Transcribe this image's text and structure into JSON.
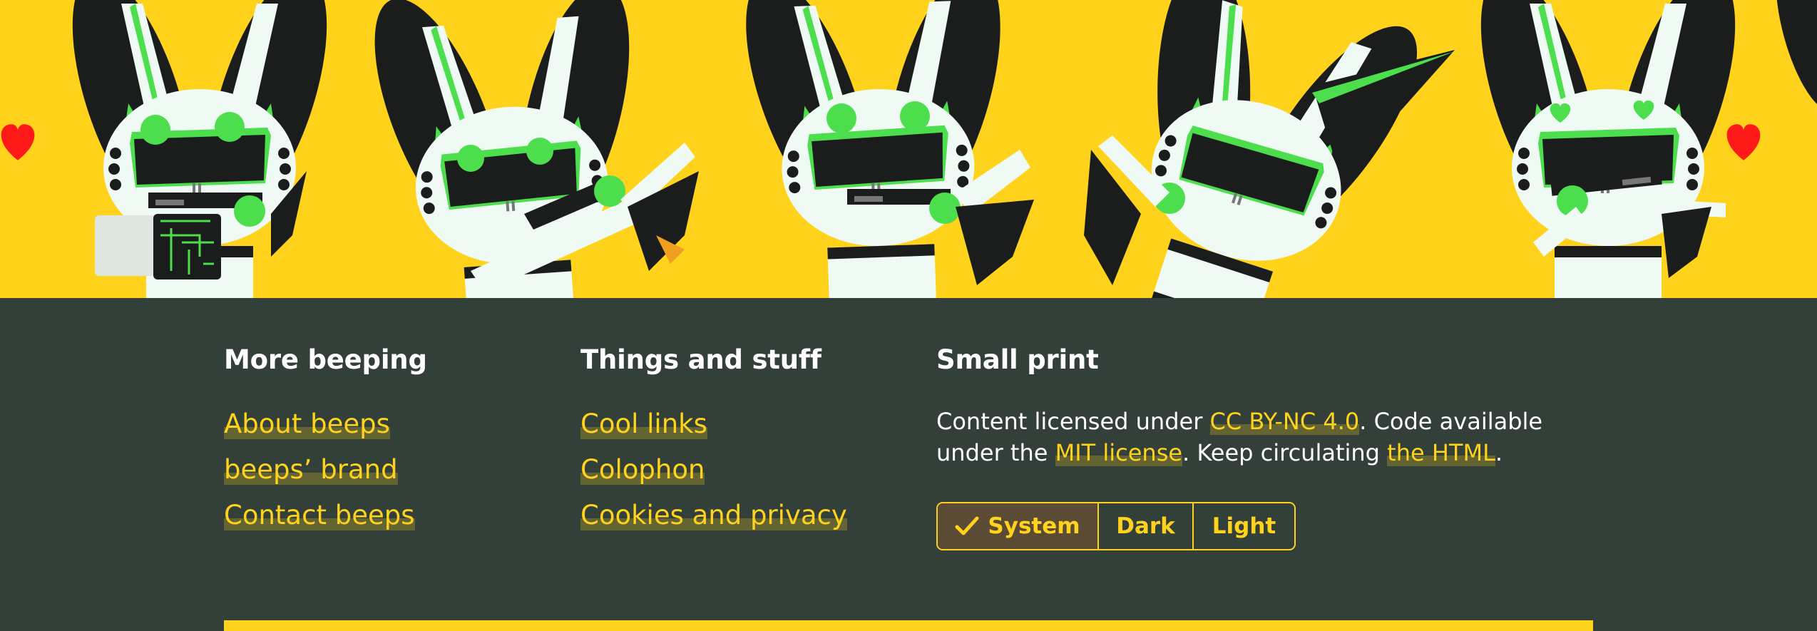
{
  "colors": {
    "banner_bg": "#ffd21c",
    "footer_bg": "#334039",
    "accent": "#ffd21c",
    "mascot_body": "#eefaf3",
    "mascot_dark": "#1b1d1c",
    "mascot_green": "#4cde4c",
    "heart": "#ff1a1a"
  },
  "banner": {
    "alt_icons": [
      "robot-mascot-icon",
      "heart-icon",
      "circuit-board-icon"
    ]
  },
  "footer": {
    "columns": [
      {
        "heading": "More beeping",
        "links": [
          "About beeps",
          "beeps’ brand",
          "Contact beeps"
        ]
      },
      {
        "heading": "Things and stuff",
        "links": [
          "Cool links",
          "Colophon",
          "Cookies and privacy"
        ]
      },
      {
        "heading": "Small print"
      }
    ],
    "small_print": {
      "t1": "Content licensed under ",
      "link1": "CC BY-NC 4.0",
      "t2": ". Code available under the ",
      "link2": "MIT license",
      "t3": ". Keep circulating ",
      "link3": "the HTML",
      "t4": "."
    },
    "theme_switch": {
      "options": [
        "System",
        "Dark",
        "Light"
      ],
      "selected": "System",
      "check_icon": "check-icon"
    }
  }
}
